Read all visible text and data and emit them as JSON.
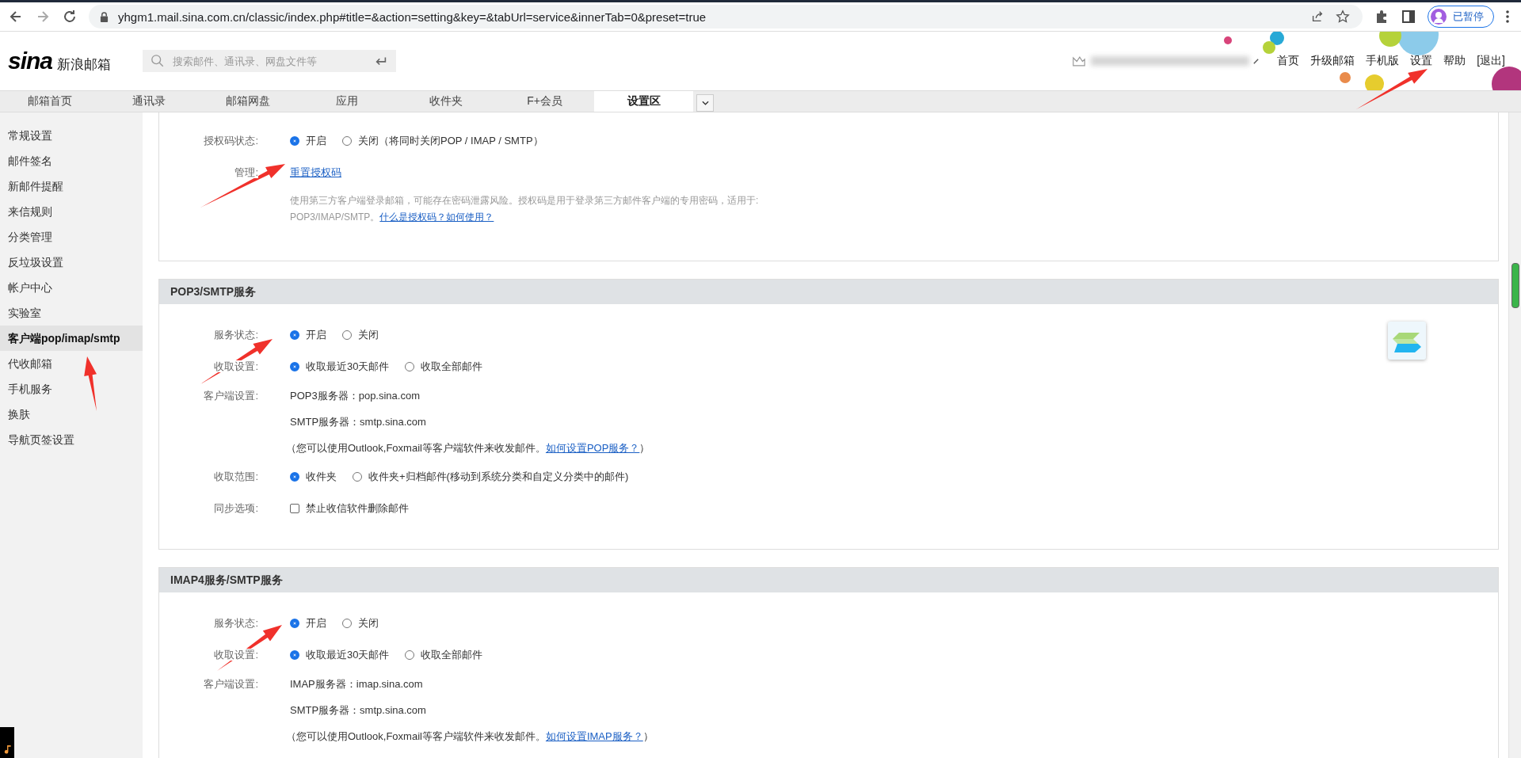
{
  "browser": {
    "url": "yhgm1.mail.sina.com.cn/classic/index.php#title=&action=setting&key=&tabUrl=service&innerTab=0&preset=true",
    "profile_label": "已暂停"
  },
  "header": {
    "logo": "sina",
    "brand": "新浪邮箱",
    "search": {
      "placeholder": "搜索邮件、通讯录、网盘文件等"
    },
    "top_links": [
      "首页",
      "升级邮箱",
      "手机版",
      "设置",
      "帮助",
      "[退出]"
    ]
  },
  "nav_tabs": [
    {
      "label": "邮箱首页",
      "selected": false
    },
    {
      "label": "通讯录",
      "selected": false
    },
    {
      "label": "邮箱网盘",
      "selected": false
    },
    {
      "label": "应用",
      "selected": false
    },
    {
      "label": "收件夹",
      "selected": false
    },
    {
      "label": "F+会员",
      "selected": false
    },
    {
      "label": "设置区",
      "selected": true
    }
  ],
  "sidebar": {
    "items": [
      {
        "label": "常规设置",
        "selected": false
      },
      {
        "label": "邮件签名",
        "selected": false
      },
      {
        "label": "新邮件提醒",
        "selected": false
      },
      {
        "label": "来信规则",
        "selected": false
      },
      {
        "label": "分类管理",
        "selected": false
      },
      {
        "label": "反垃圾设置",
        "selected": false
      },
      {
        "label": "帐户中心",
        "selected": false
      },
      {
        "label": "实验室",
        "selected": false
      },
      {
        "label": "客户端pop/imap/smtp",
        "selected": true
      },
      {
        "label": "代收邮箱",
        "selected": false
      },
      {
        "label": "手机服务",
        "selected": false
      },
      {
        "label": "换肤",
        "selected": false
      },
      {
        "label": "导航页签设置",
        "selected": false
      }
    ]
  },
  "sections": [
    {
      "rows": [
        {
          "kind": "radio",
          "label": "授权码状态:",
          "options": [
            {
              "label": "开启",
              "selected": true
            },
            {
              "label": "关闭",
              "selected": false
            }
          ],
          "hint": "（将同时关闭POP / IMAP / SMTP）"
        },
        {
          "kind": "link",
          "label": "管理:",
          "link": "重置授权码"
        },
        {
          "kind": "para",
          "lines": [
            "使用第三方客户端登录邮箱，可能存在密码泄露风险。授权码是用于登录第三方邮件客户端的专用密码，适用于:",
            "POP3/IMAP/SMTP。"
          ],
          "link": "什么是授权码？如何使用？"
        }
      ]
    },
    {
      "title": "POP3/SMTP服务",
      "rows": [
        {
          "kind": "radio",
          "label": "服务状态:",
          "options": [
            {
              "label": "开启",
              "selected": true
            },
            {
              "label": "关闭",
              "selected": false
            }
          ]
        },
        {
          "kind": "radio",
          "label": "收取设置:",
          "options": [
            {
              "label": "收取最近30天邮件",
              "selected": true
            },
            {
              "label": "收取全部邮件",
              "selected": false
            }
          ]
        },
        {
          "kind": "text",
          "label": "客户端设置:",
          "text": "POP3服务器：pop.sina.com"
        },
        {
          "kind": "text",
          "text": "SMTP服务器：smtp.sina.com"
        },
        {
          "kind": "note",
          "before": "（您可以使用Outlook,Foxmail等客户端软件来收发邮件。",
          "link": "如何设置POP服务？",
          "after": "）"
        },
        {
          "kind": "radio",
          "label": "收取范围:",
          "options": [
            {
              "label": "收件夹",
              "selected": true
            },
            {
              "label": "收件夹+归档邮件(移动到系统分类和自定义分类中的邮件)",
              "selected": false
            }
          ]
        },
        {
          "kind": "checkbox",
          "label": "同步选项:",
          "text": "禁止收信软件删除邮件",
          "checked": false
        }
      ]
    },
    {
      "title": "IMAP4服务/SMTP服务",
      "rows": [
        {
          "kind": "radio",
          "label": "服务状态:",
          "options": [
            {
              "label": "开启",
              "selected": true
            },
            {
              "label": "关闭",
              "selected": false
            }
          ]
        },
        {
          "kind": "radio",
          "label": "收取设置:",
          "options": [
            {
              "label": "收取最近30天邮件",
              "selected": true
            },
            {
              "label": "收取全部邮件",
              "selected": false
            }
          ]
        },
        {
          "kind": "text",
          "label": "客户端设置:",
          "text": "IMAP服务器：imap.sina.com"
        },
        {
          "kind": "text",
          "text": "SMTP服务器：smtp.sina.com"
        },
        {
          "kind": "note",
          "before": "（您可以使用Outlook,Foxmail等客户端软件来收发邮件。",
          "link": "如何设置IMAP服务？",
          "after": "）"
        }
      ]
    }
  ]
}
